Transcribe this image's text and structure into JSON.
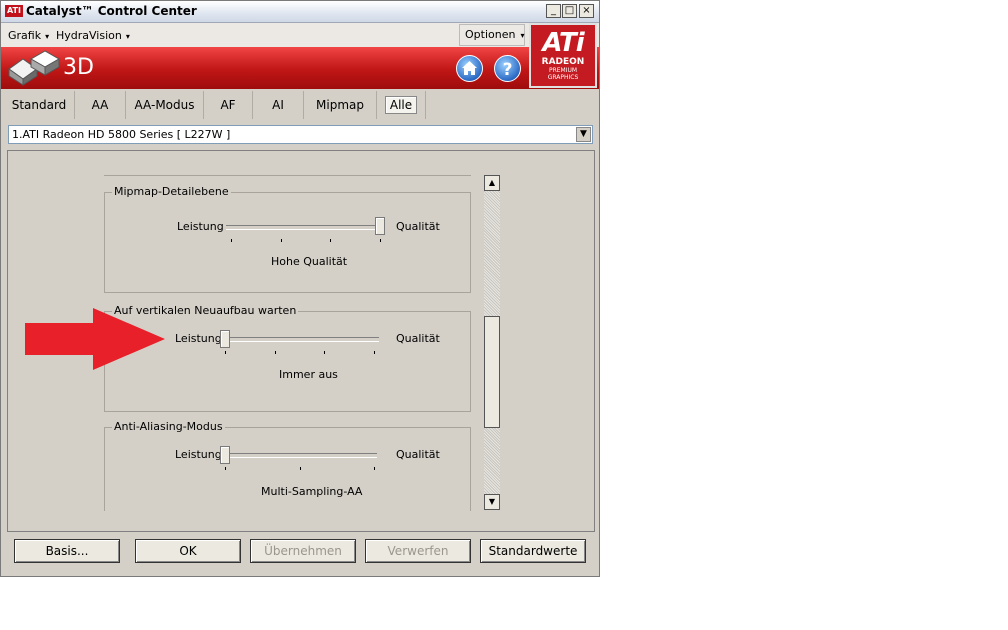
{
  "window": {
    "title": "Catalyst™ Control Center",
    "title_logo": "ATI",
    "controls": [
      "_",
      "□",
      "×"
    ]
  },
  "menu": {
    "items": [
      {
        "label": "Grafik",
        "arrow": "▾"
      },
      {
        "label": "HydraVision",
        "arrow": "▾"
      }
    ],
    "options": {
      "label": "Optionen",
      "arrow": "▾"
    }
  },
  "banner": {
    "title": "3D",
    "home_icon": "home-icon",
    "help_icon": "help-icon",
    "logo": {
      "big": "ATi",
      "line1": "RADEON",
      "line2": "PREMIUM",
      "line3": "GRAPHICS"
    }
  },
  "tabs": [
    {
      "label": "Standard"
    },
    {
      "label": "AA"
    },
    {
      "label": "AA-Modus"
    },
    {
      "label": "AF"
    },
    {
      "label": "AI"
    },
    {
      "label": "Mipmap"
    },
    {
      "label": "Alle",
      "active": true
    }
  ],
  "device_select": {
    "value": "1.ATI Radeon HD 5800 Series  [ L227W ]"
  },
  "groups": [
    {
      "title": "Mipmap-Detailebene",
      "left_label": "Leistung",
      "right_label": "Qualität",
      "value_text": "Hohe Qualität",
      "level": 1.0
    },
    {
      "title": "Auf vertikalen Neuaufbau warten",
      "left_label": "Leistung",
      "right_label": "Qualität",
      "value_text": "Immer aus",
      "level": 0.0
    },
    {
      "title": "Anti-Aliasing-Modus",
      "left_label": "Leistung",
      "right_label": "Qualität",
      "value_text": "Multi-Sampling-AA",
      "level": 0.0
    }
  ],
  "buttons": {
    "basis": {
      "label": "Basis..."
    },
    "ok": {
      "label": "OK"
    },
    "apply": {
      "label": "Übernehmen"
    },
    "discard": {
      "label": "Verwerfen"
    },
    "defaults": {
      "label": "Standardwerte"
    }
  },
  "annotation": {
    "arrow_color": "#e8202a"
  },
  "colors": {
    "banner_red": "#c01616",
    "window_bg": "#d4d0c8"
  }
}
